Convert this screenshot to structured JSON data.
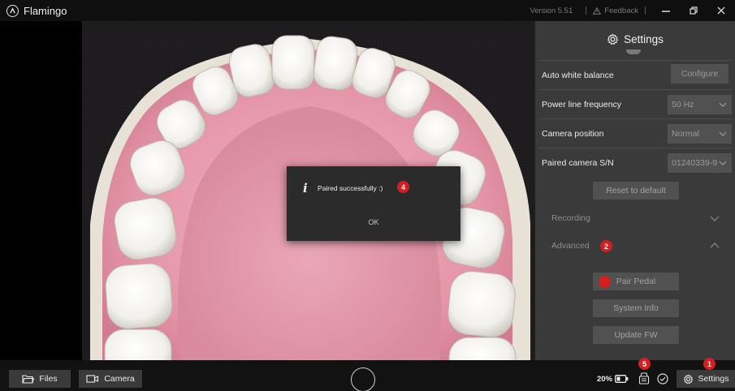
{
  "titlebar": {
    "app_name": "Flamingo",
    "version": "Version 5.51",
    "feedback": "Feedback",
    "logo_icon": "flamingo-logo-icon",
    "warning_icon": "warning-triangle-icon",
    "minimize_icon": "minimize-icon",
    "restore_icon": "restore-window-icon",
    "close_icon": "close-icon"
  },
  "dialog": {
    "icon": "info-icon",
    "message": "Paired successfully :)",
    "ok_label": "OK"
  },
  "settings": {
    "title": "Settings",
    "rows": [
      {
        "label": "Auto white balance",
        "control": "Configure"
      },
      {
        "label": "Power line frequency",
        "control": "50 Hz"
      },
      {
        "label": "Camera position",
        "control": "Normal"
      },
      {
        "label": "Paired camera S/N",
        "control": "01240339-9"
      }
    ],
    "reset_label": "Reset to default",
    "recording_label": "Recording",
    "advanced_label": "Advanced",
    "pair_pedal_label": "Pair Pedal",
    "system_info_label": "System Info",
    "update_fw_label": "Update FW"
  },
  "bottombar": {
    "files_label": "Files",
    "camera_label": "Camera",
    "battery_percent": "20%",
    "settings_label": "Settings",
    "icons": [
      "folder-icon",
      "camera-icon",
      "record-icon",
      "battery-icon",
      "pedal-icon",
      "check-circle-icon",
      "gear-icon"
    ]
  },
  "badges": [
    "1",
    "2",
    "",
    "4",
    "5"
  ],
  "colors": {
    "badge": "#d31f1f",
    "panel_bg": "#3a3a3a",
    "control_bg": "#515151",
    "gum": "#e79aaa",
    "bottombar_bg": "#121212"
  }
}
